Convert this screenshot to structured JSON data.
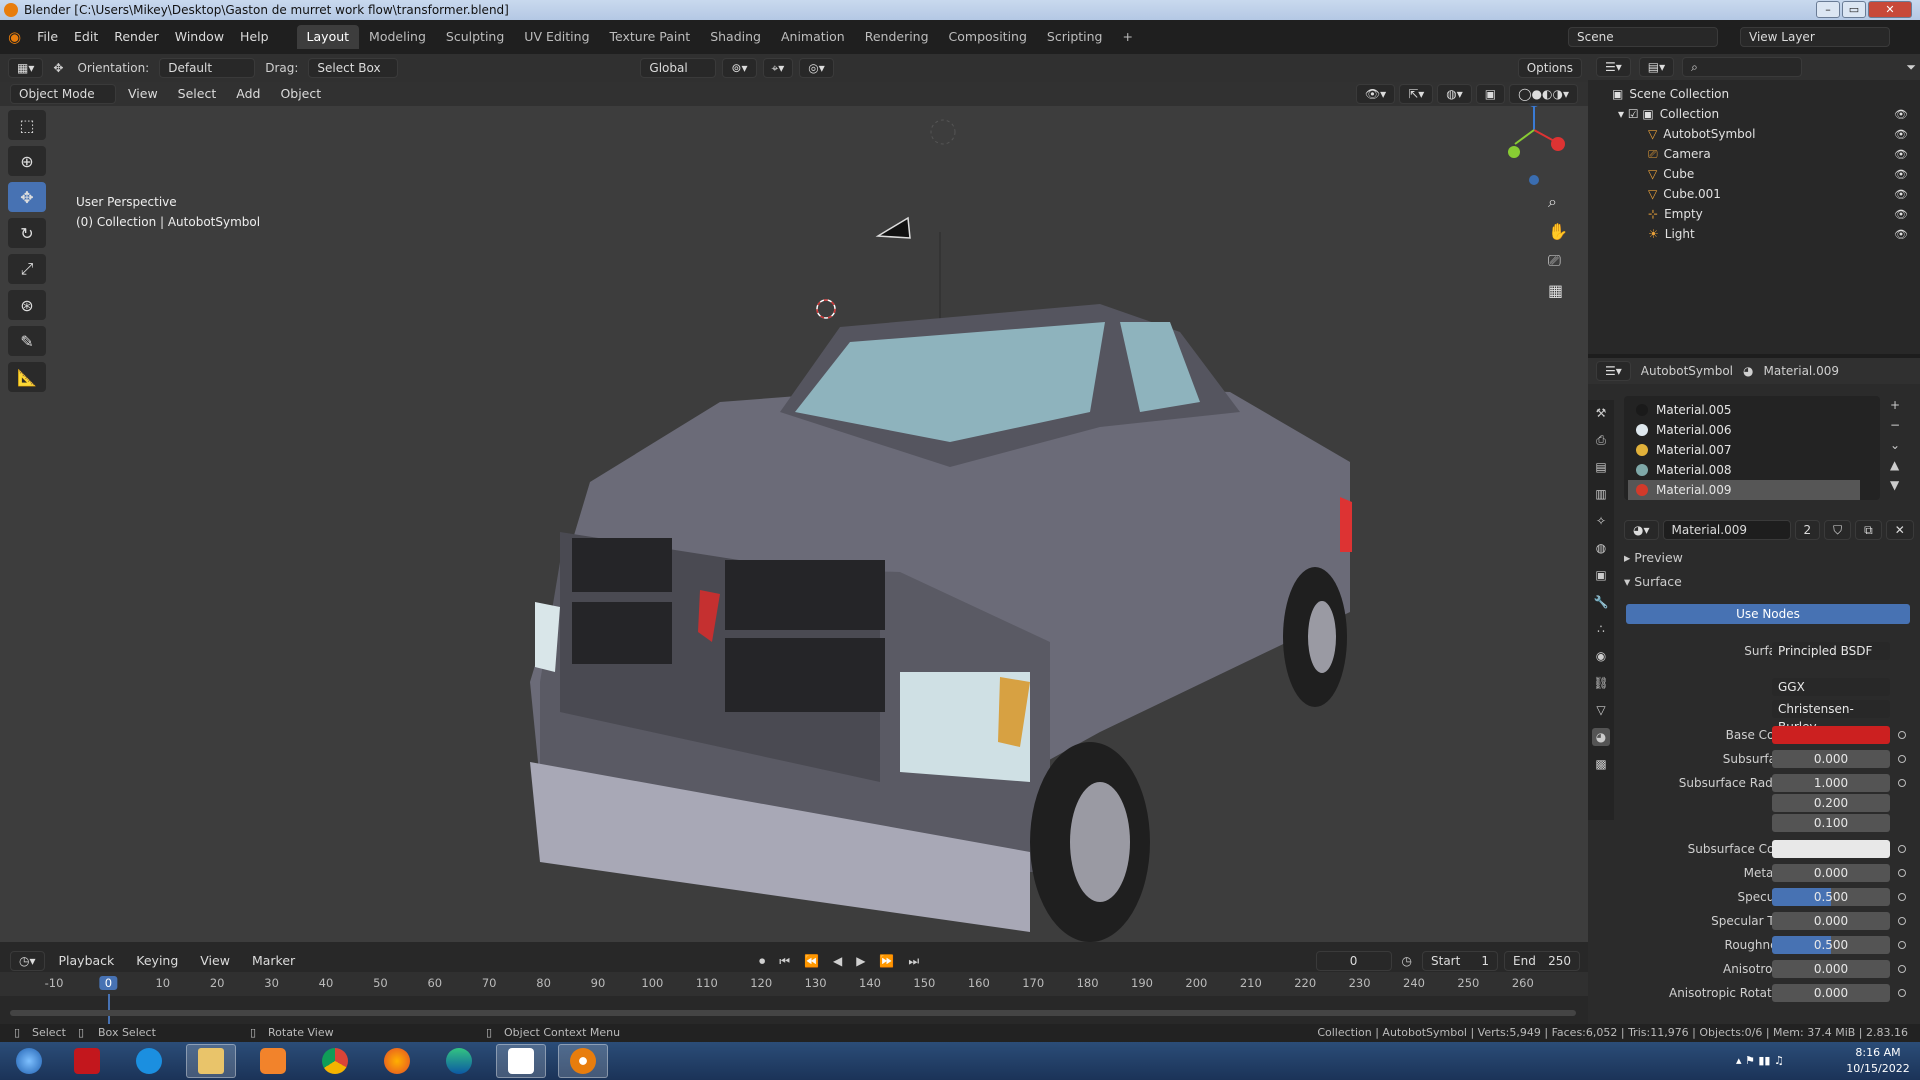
{
  "titlebar": {
    "title": "Blender [C:\\Users\\Mikey\\Desktop\\Gaston de murret work flow\\transformer.blend]"
  },
  "menubar": {
    "menus": [
      "File",
      "Edit",
      "Render",
      "Window",
      "Help"
    ],
    "workspaces": [
      "Layout",
      "Modeling",
      "Sculpting",
      "UV Editing",
      "Texture Paint",
      "Shading",
      "Animation",
      "Rendering",
      "Compositing",
      "Scripting"
    ],
    "active_workspace": "Layout",
    "scene": "Scene",
    "view_layer": "View Layer"
  },
  "header": {
    "orientation_label": "Orientation:",
    "orientation_value": "Default",
    "drag_label": "Drag:",
    "drag_value": "Select Box",
    "transform_space": "Global",
    "options": "Options"
  },
  "viewport_header": {
    "mode": "Object Mode",
    "menus": [
      "View",
      "Select",
      "Add",
      "Object"
    ]
  },
  "viewport": {
    "perspective": "User Perspective",
    "collection_info": "(0) Collection | AutobotSymbol"
  },
  "outliner": {
    "root": "Scene Collection",
    "collection": "Collection",
    "items": [
      "AutobotSymbol",
      "Camera",
      "Cube",
      "Cube.001",
      "Empty",
      "Light"
    ]
  },
  "properties": {
    "object_name": "AutobotSymbol",
    "material_name": "Material.009",
    "slots": [
      {
        "name": "Material.005",
        "color": "#1a1a1a"
      },
      {
        "name": "Material.006",
        "color": "#dfe8ee"
      },
      {
        "name": "Material.007",
        "color": "#e1b13a"
      },
      {
        "name": "Material.008",
        "color": "#7fa8a8"
      },
      {
        "name": "Material.009",
        "color": "#d23a2a"
      }
    ],
    "material_field": "Material.009",
    "users": "2",
    "panel_preview": "Preview",
    "panel_surface": "Surface",
    "use_nodes": "Use Nodes",
    "surface_label": "Surface",
    "surface_value": "Principled BSDF",
    "distribution": "GGX",
    "subsurface_method": "Christensen-Burley",
    "params": [
      {
        "label": "Base Color",
        "value": "",
        "color": "#cc2020"
      },
      {
        "label": "Subsurface",
        "value": "0.000"
      },
      {
        "label": "Subsurface Radius",
        "value": "1.000"
      },
      {
        "label": "",
        "value": "0.200"
      },
      {
        "label": "",
        "value": "0.100"
      },
      {
        "label": "Subsurface Color",
        "value": "",
        "color": "#e8e8e8"
      },
      {
        "label": "Metallic",
        "value": "0.000"
      },
      {
        "label": "Specular",
        "value": "0.500",
        "fill": 0.5
      },
      {
        "label": "Specular Tint",
        "value": "0.000"
      },
      {
        "label": "Roughness",
        "value": "0.500",
        "fill": 0.5
      },
      {
        "label": "Anisotropic",
        "value": "0.000"
      },
      {
        "label": "Anisotropic Rotation",
        "value": "0.000"
      }
    ]
  },
  "timeline": {
    "menus": [
      "Playback",
      "Keying",
      "View",
      "Marker"
    ],
    "current_frame": "0",
    "start_label": "Start",
    "start": "1",
    "end_label": "End",
    "end": "250",
    "ticks": [
      "-10",
      "0",
      "10",
      "20",
      "30",
      "40",
      "50",
      "60",
      "70",
      "80",
      "90",
      "100",
      "110",
      "120",
      "130",
      "140",
      "150",
      "160",
      "170",
      "180",
      "190",
      "200",
      "210",
      "220",
      "230",
      "240",
      "250",
      "260"
    ]
  },
  "statusbar": {
    "select": "Select",
    "box_select": "Box Select",
    "rotate_view": "Rotate View",
    "context_menu": "Object Context Menu",
    "stats": "Collection | AutobotSymbol | Verts:5,949 | Faces:6,052 | Tris:11,976 | Objects:0/6 | Mem: 37.4 MiB | 2.83.16"
  },
  "taskbar": {
    "time": "8:16 AM",
    "date": "10/15/2022"
  }
}
